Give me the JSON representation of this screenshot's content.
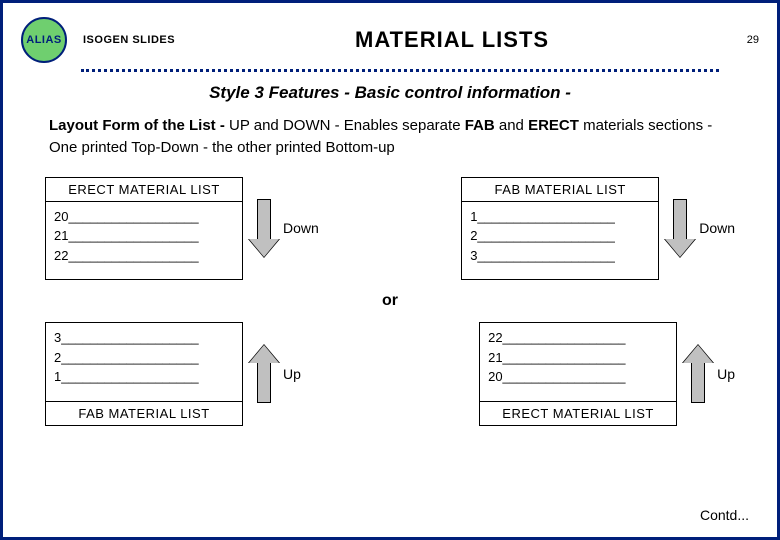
{
  "header": {
    "badge": "ALIAS",
    "isogen": "ISOGEN SLIDES",
    "title": "MATERIAL LISTS",
    "page": "29"
  },
  "subtitle": "Style 3 Features - Basic control information -",
  "body": {
    "lead_bold": "Layout Form of the List -",
    "up": "UP",
    "and": " and ",
    "down": "DOWN",
    "mid1": " - Enables separate ",
    "fab": "FAB",
    "mid2": " and ",
    "erect": "ERECT",
    "tail": " materials sections - One printed Top-Down - the other printed Bottom-up"
  },
  "diagram": {
    "top": {
      "left": {
        "title": "ERECT MATERIAL  LIST",
        "rows": "20__________________\n21__________________\n22__________________",
        "arrow": "Down"
      },
      "right": {
        "title": "FAB  MATERIAL  LIST",
        "rows": "1___________________\n2___________________\n3___________________",
        "arrow": "Down"
      }
    },
    "or": "or",
    "bottom": {
      "left": {
        "rows": "3___________________\n2___________________\n1___________________",
        "footer": "FAB  MATERIAL  LIST",
        "arrow": "Up"
      },
      "right": {
        "rows": "22_________________\n21_________________\n20_________________",
        "footer": "ERECT MATERIAL  LIST",
        "arrow": "Up"
      }
    }
  },
  "contd": "Contd..."
}
